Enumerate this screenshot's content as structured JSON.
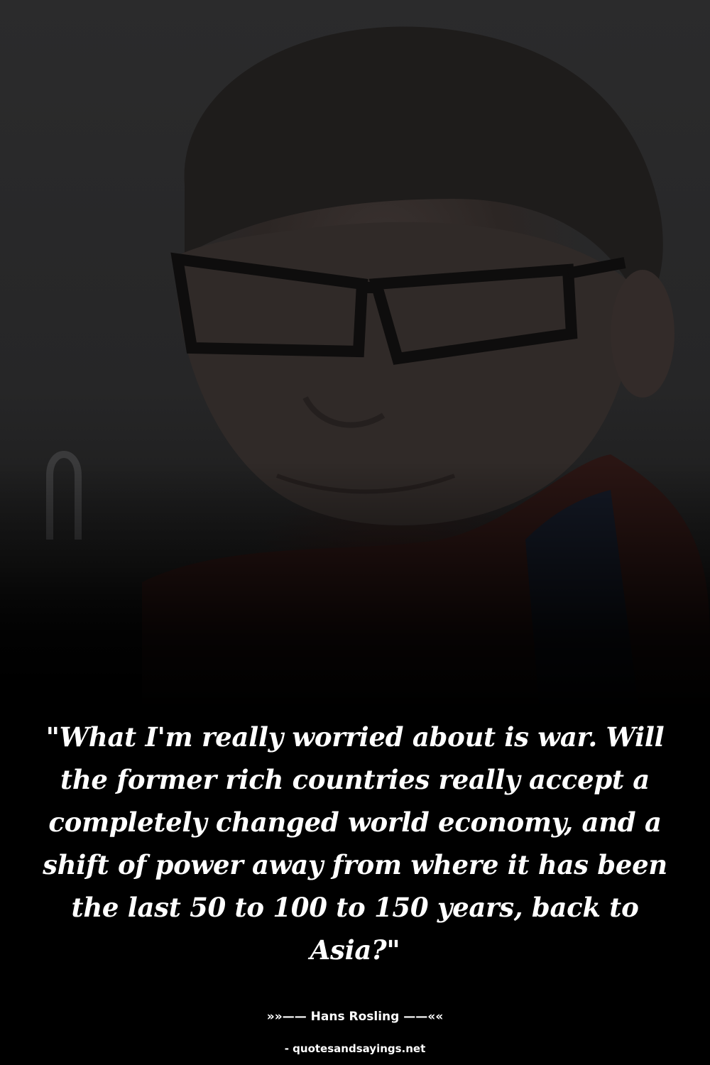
{
  "quote": {
    "text": "\"What I'm really worried about is war. Will the former rich countries really accept a completely changed world economy, and a shift of power away from where it has been the last 50 to 100 to 150 years, back to Asia?\""
  },
  "attribution": {
    "author_line": "»»—— Hans Rosling ——««"
  },
  "footer": {
    "source": "- quotesandsayings.net"
  },
  "colors": {
    "background": "#000000",
    "text": "#ffffff"
  }
}
